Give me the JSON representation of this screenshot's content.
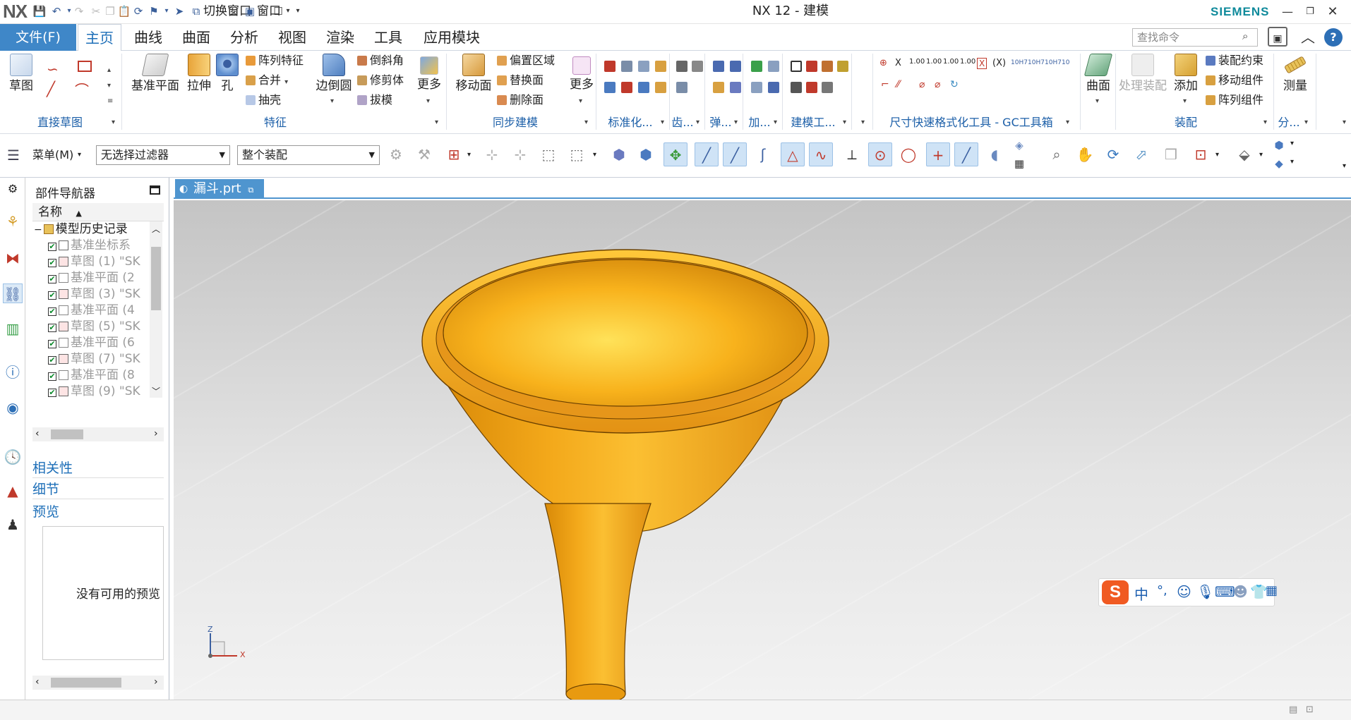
{
  "titlebar": {
    "logo": "NX",
    "switch_window": "切换窗口",
    "window_menu": "窗口",
    "title": "NX 12 - 建模",
    "brand": "SIEMENS"
  },
  "tabs": {
    "file": "文件(F)",
    "items": [
      "主页",
      "曲线",
      "曲面",
      "分析",
      "视图",
      "渲染",
      "工具",
      "应用模块"
    ],
    "active": "主页",
    "search_placeholder": "查找命令"
  },
  "ribbon": {
    "direct_sketch": {
      "label": "直接草图",
      "sketch": "草图"
    },
    "feature": {
      "label": "特征",
      "datum_plane": "基准平面",
      "extrude": "拉伸",
      "hole": "孔",
      "pattern_feature": "阵列特征",
      "unite": "合并",
      "shell": "抽壳",
      "edge_blend": "边倒圆",
      "chamfer": "倒斜角",
      "trim_body": "修剪体",
      "draft": "拔模",
      "more": "更多"
    },
    "sync": {
      "label": "同步建模",
      "move_face": "移动面",
      "offset_region": "偏置区域",
      "replace_face": "替换面",
      "delete_face": "删除面",
      "more": "更多"
    },
    "small_groups": [
      "标准化...",
      "齿...",
      "弹...",
      "加...",
      "建模工...",
      "尺寸快速格式化工具 - GC工具箱"
    ],
    "surface": "曲面",
    "assembly": {
      "label": "装配",
      "process_assembly": "处理装配",
      "add": "添加",
      "assembly_constraint": "装配约束",
      "move_component": "移动组件",
      "pattern_component": "阵列组件"
    },
    "measure": {
      "label": "分...",
      "measure": "测量"
    }
  },
  "toolbar2": {
    "menu": "菜单(M)",
    "filter": "无选择过滤器",
    "scope": "整个装配"
  },
  "navigator": {
    "title": "部件导航器",
    "column": "名称",
    "root": "模型历史记录",
    "items": [
      "基准坐标系",
      "草图 (1) \"SK",
      "基准平面 (2",
      "草图 (3) \"SK",
      "基准平面 (4",
      "草图 (5) \"SK",
      "基准平面 (6",
      "草图 (7) \"SK",
      "基准平面 (8",
      "草图 (9) \"SK"
    ],
    "panels": [
      "相关性",
      "细节",
      "预览"
    ],
    "no_preview": "没有可用的预览"
  },
  "document": {
    "tab": "漏斗.prt"
  },
  "triad": {
    "x": "X",
    "z": "Z"
  },
  "ime": {
    "mode": "中",
    "punct": "°,"
  },
  "colors": {
    "accent": "#3f87c8",
    "funnel": "#f2a516",
    "brand": "#0f8a9b"
  }
}
